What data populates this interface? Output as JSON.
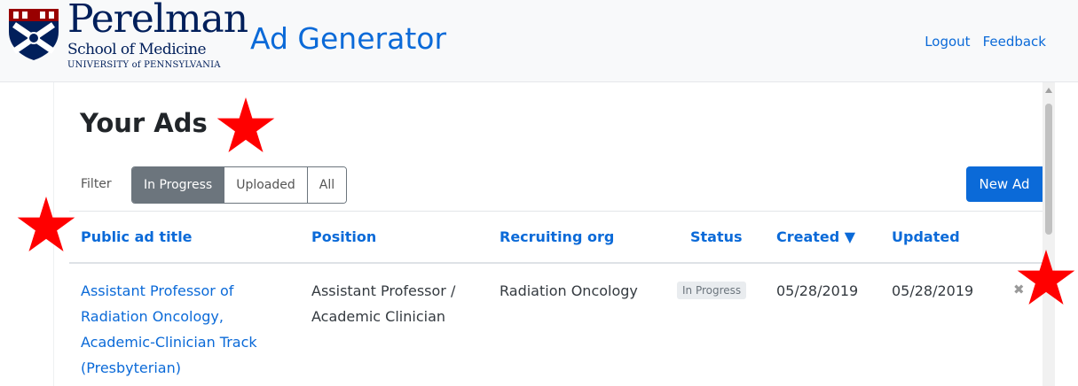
{
  "header": {
    "logo": {
      "main": "Perelman",
      "sub": "School of Medicine",
      "university": "UNIVERSITY of PENNSYLVANIA"
    },
    "app_title": "Ad Generator",
    "links": {
      "logout": "Logout",
      "feedback": "Feedback"
    }
  },
  "page": {
    "title": "Your Ads",
    "filter": {
      "label": "Filter",
      "options": [
        "In Progress",
        "Uploaded",
        "All"
      ],
      "selected": "In Progress"
    },
    "new_ad_label": "New Ad"
  },
  "table": {
    "columns": [
      "Public ad title",
      "Position",
      "Recruiting org",
      "Status",
      "Created ▼",
      "Updated"
    ],
    "sorted_column": "Created",
    "rows": [
      {
        "title": "Assistant Professor of Radiation Oncology, Academic-Clinician Track (Presbyterian)",
        "position": "Assistant Professor / Academic Clinician",
        "org": "Radiation Oncology",
        "status": "In Progress",
        "created": "05/28/2019",
        "updated": "05/28/2019",
        "delete_glyph": "✖"
      }
    ]
  },
  "annotations": {
    "star_color": "#ff0000",
    "star_count": 3
  },
  "colors": {
    "link": "#0b6ad8",
    "primary_button": "#0b6ad8",
    "active_filter": "#6c757d"
  }
}
